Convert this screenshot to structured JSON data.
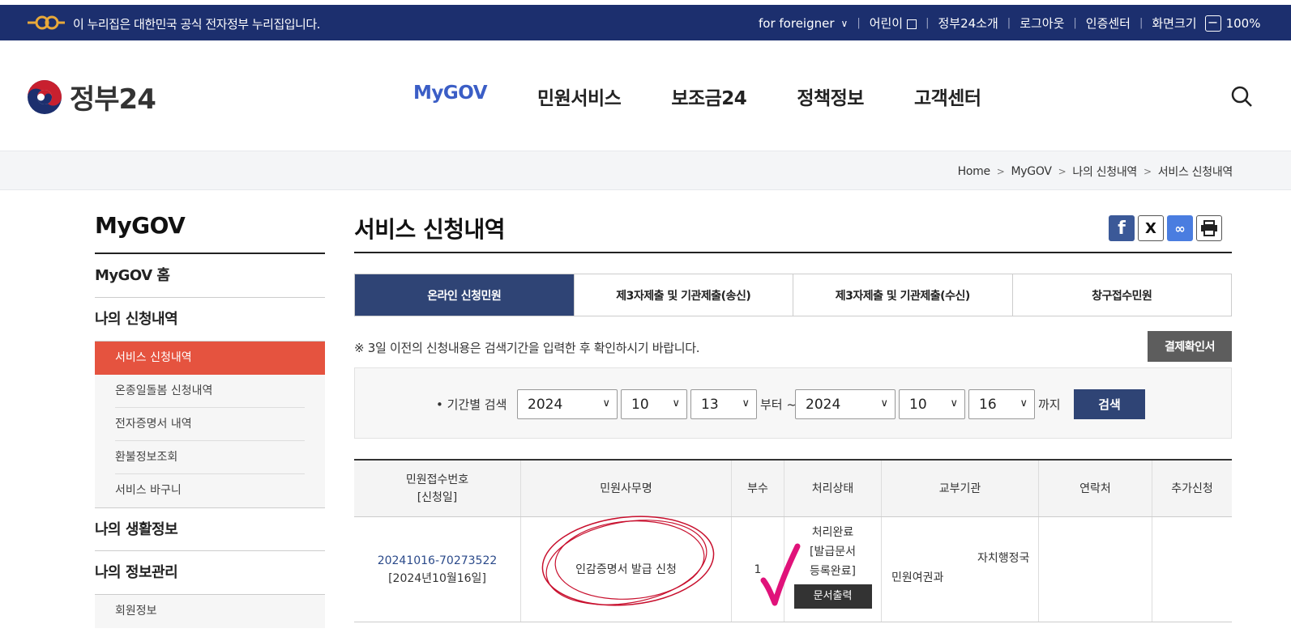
{
  "gov_banner": {
    "text": "이 누리집은 대한민국 공식 전자정부 누리집입니다.",
    "links": [
      "for foreigner",
      "어린이",
      "정부24소개",
      "로그아웃",
      "인증센터",
      "화면크기"
    ],
    "zoom": "100%"
  },
  "header": {
    "logo_text": "정부24",
    "nav": [
      "MyGOV",
      "민원서비스",
      "보조금24",
      "정책정보",
      "고객센터"
    ]
  },
  "breadcrumb": [
    "Home",
    "MyGOV",
    "나의 신청내역",
    "서비스 신청내역"
  ],
  "sidebar": {
    "title": "MyGOV",
    "items": [
      "MyGOV 홈",
      "나의 신청내역"
    ],
    "sub_items": [
      "서비스 신청내역",
      "온종일돌봄 신청내역",
      "전자증명서 내역",
      "환불정보조회",
      "서비스 바구니"
    ],
    "items_after": [
      "나의 생활정보",
      "나의 정보관리"
    ],
    "sub_items_after": [
      "회원정보"
    ]
  },
  "main": {
    "title": "서비스 신청내역",
    "tabs": [
      "온라인 신청민원",
      "제3자제출 및 기관제출(송신)",
      "제3자제출 및 기관제출(수신)",
      "창구접수민원"
    ],
    "notice": "※ 3일 이전의 신청내용은 검색기간을 입력한 후 확인하시기 바랍니다.",
    "receipt_button": "결제확인서",
    "search": {
      "label": "• 기간별 검색",
      "from_year": "2024",
      "from_month": "10",
      "from_day": "13",
      "from_text": "부터 ~",
      "to_year": "2024",
      "to_month": "10",
      "to_day": "16",
      "to_text": "까지",
      "button": "검색"
    },
    "table": {
      "headers": [
        "민원접수번호",
        "[신청일]",
        "민원사무명",
        "부수",
        "처리상태",
        "교부기관",
        "연락처",
        "추가신청"
      ],
      "rows": [
        {
          "receipt_no": "20241016-70273522",
          "date": "[2024년10월16일]",
          "name": "인감증명서 발급 신청",
          "copies": "1",
          "status_1": "처리완료",
          "status_2": "[발급문서",
          "status_3": "등록완료]",
          "print_button": "문서출력",
          "agency_1": "자치행정국",
          "agency_2": "민원여권과",
          "contact": "",
          "extra": ""
        }
      ]
    }
  }
}
